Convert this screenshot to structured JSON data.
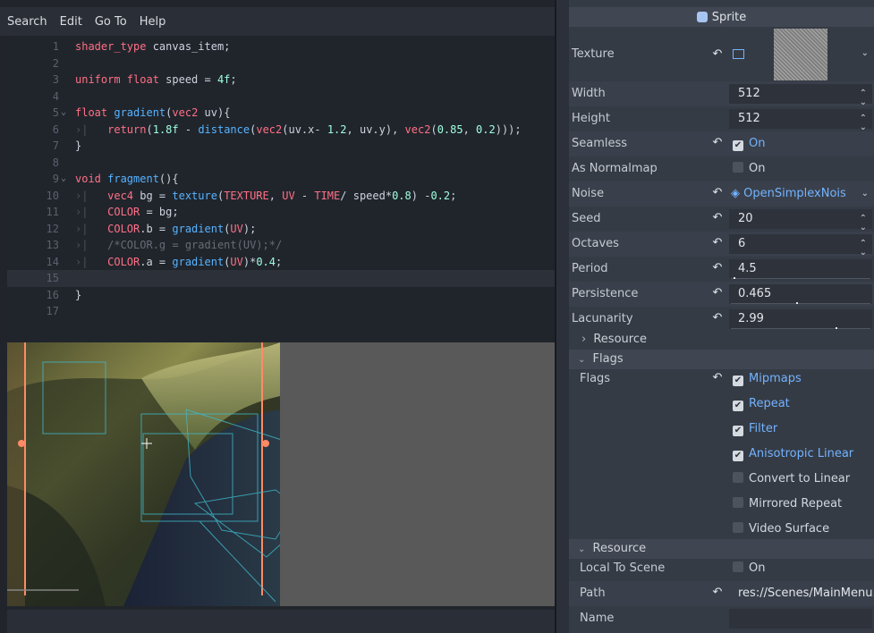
{
  "menubar": [
    "Search",
    "Edit",
    "Go To",
    "Help"
  ],
  "code_lines": [
    {
      "n": "1",
      "fold": "",
      "parts": [
        [
          "kw",
          "shader_type "
        ],
        [
          "id",
          "canvas_item;"
        ]
      ]
    },
    {
      "n": "2",
      "fold": "",
      "parts": []
    },
    {
      "n": "3",
      "fold": "",
      "parts": [
        [
          "kw",
          "uniform "
        ],
        [
          "ty",
          "float "
        ],
        [
          "id",
          "speed = "
        ],
        [
          "num",
          "4f"
        ],
        [
          "id",
          ";"
        ]
      ]
    },
    {
      "n": "4",
      "fold": "",
      "parts": []
    },
    {
      "n": "5",
      "fold": "⌄",
      "parts": [
        [
          "ty",
          "float "
        ],
        [
          "fn",
          "gradient"
        ],
        [
          "id",
          "("
        ],
        [
          "ty",
          "vec2 "
        ],
        [
          "id",
          "uv){"
        ]
      ]
    },
    {
      "n": "6",
      "fold": "",
      "parts": [
        [
          "tab",
          "›|   "
        ],
        [
          "kw",
          "return"
        ],
        [
          "id",
          "("
        ],
        [
          "num",
          "1.8f"
        ],
        [
          "id",
          " - "
        ],
        [
          "fn",
          "distance"
        ],
        [
          "id",
          "("
        ],
        [
          "ty",
          "vec2"
        ],
        [
          "id",
          "(uv.x- "
        ],
        [
          "num",
          "1.2"
        ],
        [
          "id",
          ", uv.y), "
        ],
        [
          "ty",
          "vec2"
        ],
        [
          "id",
          "("
        ],
        [
          "num",
          "0.85"
        ],
        [
          "id",
          ", "
        ],
        [
          "num",
          "0.2"
        ],
        [
          "id",
          ")));"
        ]
      ]
    },
    {
      "n": "7",
      "fold": "",
      "parts": [
        [
          "id",
          "}"
        ]
      ]
    },
    {
      "n": "8",
      "fold": "",
      "parts": []
    },
    {
      "n": "9",
      "fold": "⌄",
      "parts": [
        [
          "kw",
          "void "
        ],
        [
          "fn",
          "fragment"
        ],
        [
          "id",
          "(){"
        ]
      ]
    },
    {
      "n": "10",
      "fold": "",
      "parts": [
        [
          "tab",
          "›|   "
        ],
        [
          "ty",
          "vec4 "
        ],
        [
          "id",
          "bg = "
        ],
        [
          "fn",
          "texture"
        ],
        [
          "id",
          "("
        ],
        [
          "bi",
          "TEXTURE"
        ],
        [
          "id",
          ", "
        ],
        [
          "bi",
          "UV"
        ],
        [
          "id",
          " - "
        ],
        [
          "bi",
          "TIME"
        ],
        [
          "id",
          "/ speed*"
        ],
        [
          "num",
          "0.8"
        ],
        [
          "id",
          ") -"
        ],
        [
          "num",
          "0.2"
        ],
        [
          "id",
          ";"
        ]
      ]
    },
    {
      "n": "11",
      "fold": "",
      "parts": [
        [
          "tab",
          "›|   "
        ],
        [
          "bi",
          "COLOR"
        ],
        [
          "id",
          " = bg;"
        ]
      ]
    },
    {
      "n": "12",
      "fold": "",
      "parts": [
        [
          "tab",
          "›|   "
        ],
        [
          "bi",
          "COLOR"
        ],
        [
          "id",
          ".b = "
        ],
        [
          "fn",
          "gradient"
        ],
        [
          "id",
          "("
        ],
        [
          "bi",
          "UV"
        ],
        [
          "id",
          ");"
        ]
      ]
    },
    {
      "n": "13",
      "fold": "",
      "parts": [
        [
          "tab",
          "›|   "
        ],
        [
          "cm",
          "/*COLOR.g = gradient(UV);*/"
        ]
      ]
    },
    {
      "n": "14",
      "fold": "",
      "parts": [
        [
          "tab",
          "›|   "
        ],
        [
          "bi",
          "COLOR"
        ],
        [
          "id",
          ".a = "
        ],
        [
          "fn",
          "gradient"
        ],
        [
          "id",
          "("
        ],
        [
          "bi",
          "UV"
        ],
        [
          "id",
          ")*"
        ],
        [
          "num",
          "0.4"
        ],
        [
          "id",
          ";"
        ]
      ]
    },
    {
      "n": "15",
      "fold": "",
      "parts": [],
      "current": true
    },
    {
      "n": "16",
      "fold": "",
      "parts": [
        [
          "id",
          "}"
        ]
      ]
    },
    {
      "n": "17",
      "fold": "",
      "parts": []
    }
  ],
  "inspector": {
    "title": "Sprite",
    "texture_label": "Texture",
    "props": [
      {
        "label": "Width",
        "value": "512",
        "revert": false,
        "spin": true
      },
      {
        "label": "Height",
        "value": "512",
        "revert": false,
        "spin": true
      },
      {
        "label": "Seamless",
        "value": "On",
        "revert": true,
        "check": "on"
      },
      {
        "label": "As Normalmap",
        "value": "On",
        "revert": false,
        "check": "off"
      },
      {
        "label": "Noise",
        "value": "OpenSimplexNois",
        "revert": true,
        "noise": true
      },
      {
        "label": "Seed",
        "value": "20",
        "revert": true,
        "spin": true
      },
      {
        "label": "Octaves",
        "value": "6",
        "revert": true,
        "spin": true
      },
      {
        "label": "Period",
        "value": "4.5",
        "revert": true,
        "slider": 0.02
      },
      {
        "label": "Persistence",
        "value": "0.465",
        "revert": true,
        "slider": 0.465
      },
      {
        "label": "Lacunarity",
        "value": "2.99",
        "revert": true,
        "slider": 0.75
      }
    ],
    "resource_collapsed": "Resource",
    "flags_section": "Flags",
    "flags_label": "Flags",
    "flags": [
      {
        "label": "Mipmaps",
        "on": true
      },
      {
        "label": "Repeat",
        "on": true
      },
      {
        "label": "Filter",
        "on": true
      },
      {
        "label": "Anisotropic Linear",
        "on": true
      },
      {
        "label": "Convert to Linear",
        "on": false
      },
      {
        "label": "Mirrored Repeat",
        "on": false
      },
      {
        "label": "Video Surface",
        "on": false
      }
    ],
    "resource_section": "Resource",
    "local_label": "Local To Scene",
    "local_value": "On",
    "path_label": "Path",
    "path_value": "res://Scenes/MainMenu.",
    "name_label": "Name",
    "name_value": ""
  },
  "colors": {
    "accent": "#72b3ff",
    "guide": "#ff8a65",
    "gizmo": "#3fb8c9"
  },
  "icons": {
    "sprite": "sprite-icon",
    "revert": "revert-icon",
    "noise": "noise-resource-icon"
  }
}
